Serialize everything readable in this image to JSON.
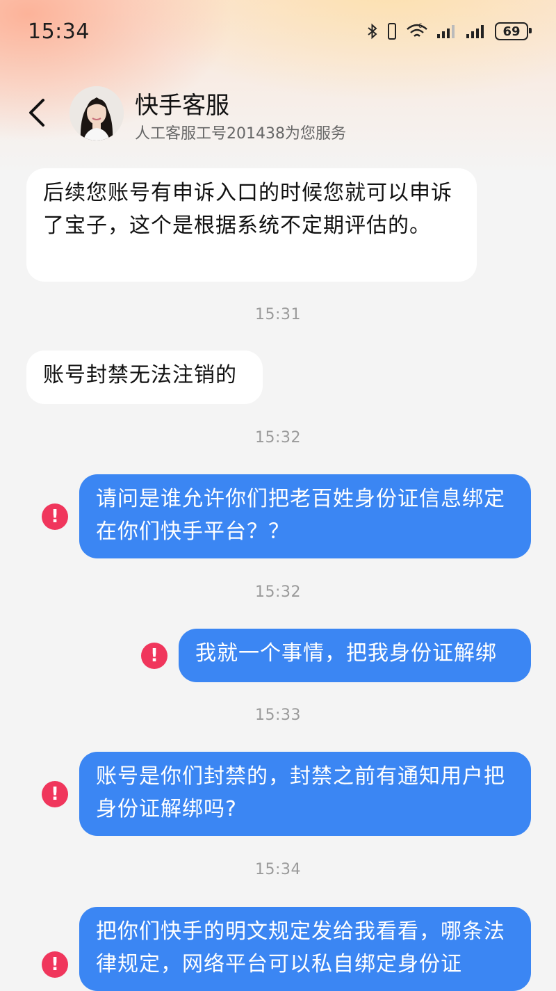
{
  "status_bar": {
    "time": "15:34",
    "battery": "69",
    "icons": [
      "bluetooth-icon",
      "vibrate-icon",
      "wifi-icon",
      "signal-icon",
      "signal-icon",
      "battery-icon"
    ]
  },
  "header": {
    "title": "快手客服",
    "subtitle": "人工客服工号201438为您服务",
    "back_icon": "back-arrow-icon"
  },
  "messages": [
    {
      "from": "agent",
      "text": "后续您账号有申诉入口的时候您就可以申诉了宝子，这个是根据系统不定期评估的。"
    },
    {
      "time": "15:31"
    },
    {
      "from": "agent",
      "text": "账号封禁无法注销的"
    },
    {
      "time": "15:32"
    },
    {
      "from": "user",
      "failed": true,
      "text": "请问是谁允许你们把老百姓身份证信息绑定在你们快手平台？？"
    },
    {
      "time": "15:32"
    },
    {
      "from": "user",
      "failed": true,
      "text": "我就一个事情，把我身份证解绑"
    },
    {
      "time": "15:33"
    },
    {
      "from": "user",
      "failed": true,
      "text": "账号是你们封禁的，封禁之前有通知用户把身份证解绑吗?"
    },
    {
      "time": "15:34"
    },
    {
      "from": "user",
      "failed": true,
      "text": "把你们快手的明文规定发给我看看，哪条法律规定，网络平台可以私自绑定身份证"
    }
  ],
  "colors": {
    "user_bubble": "#3b86f3",
    "agent_bubble": "#ffffff",
    "error": "#f0365c",
    "background": "#f4f4f4"
  },
  "error_icon_glyph": "!"
}
